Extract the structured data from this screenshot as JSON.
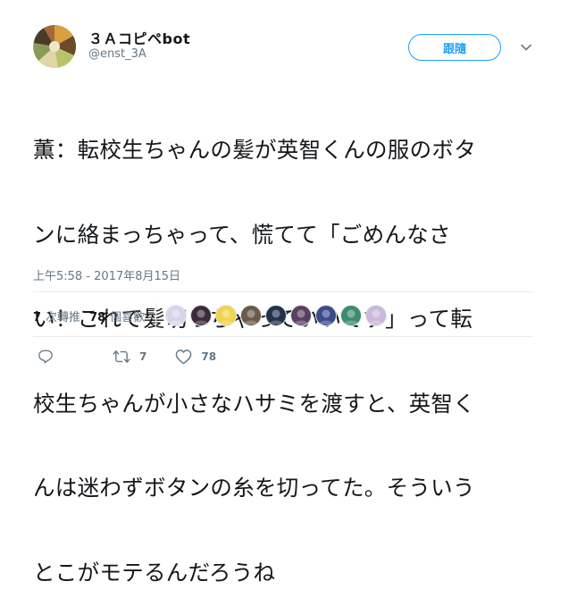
{
  "author": {
    "display_name": "３Ａコピペbot",
    "handle": "@enst_3A"
  },
  "follow_button": {
    "label": "跟隨"
  },
  "tweet": {
    "lines": [
      "薫：転校生ちゃんの髪が英智くんの服のボタ",
      "ンに絡まっちゃって、慌てて「ごめんなさ",
      "い！これで髪切っちゃっていいです」って転",
      "校生ちゃんが小さなハサミを渡すと、英智く",
      "んは迷わずボタンの糸を切ってた。そういう",
      "とこがモテるんだろうね"
    ],
    "timestamp": "上午5:58 - 2017年8月15日"
  },
  "stats": {
    "retweets": {
      "count": "7",
      "label": "次轉推"
    },
    "likes": {
      "count": "78",
      "label": "個喜歡"
    }
  },
  "likers": [
    {
      "icon": "liker-avatar",
      "color": "#d9d4e8"
    },
    {
      "icon": "liker-avatar",
      "color": "#3a2a3a"
    },
    {
      "icon": "liker-avatar",
      "color": "#f2d34a"
    },
    {
      "icon": "liker-avatar",
      "color": "#6b5a4a"
    },
    {
      "icon": "liker-avatar",
      "color": "#22324a"
    },
    {
      "icon": "liker-avatar",
      "color": "#5a4060"
    },
    {
      "icon": "liker-avatar",
      "color": "#3a4a8a"
    },
    {
      "icon": "liker-avatar",
      "color": "#3e8a6e"
    },
    {
      "icon": "liker-avatar",
      "color": "#c9b8d8"
    }
  ],
  "actions": {
    "reply": {
      "icon": "reply-icon"
    },
    "retweet": {
      "icon": "retweet-icon",
      "count": "7"
    },
    "like": {
      "icon": "heart-icon",
      "count": "78"
    }
  },
  "colors": {
    "accent": "#1da1f2",
    "secondary_text": "#657786",
    "divider": "#e6ecf0"
  }
}
